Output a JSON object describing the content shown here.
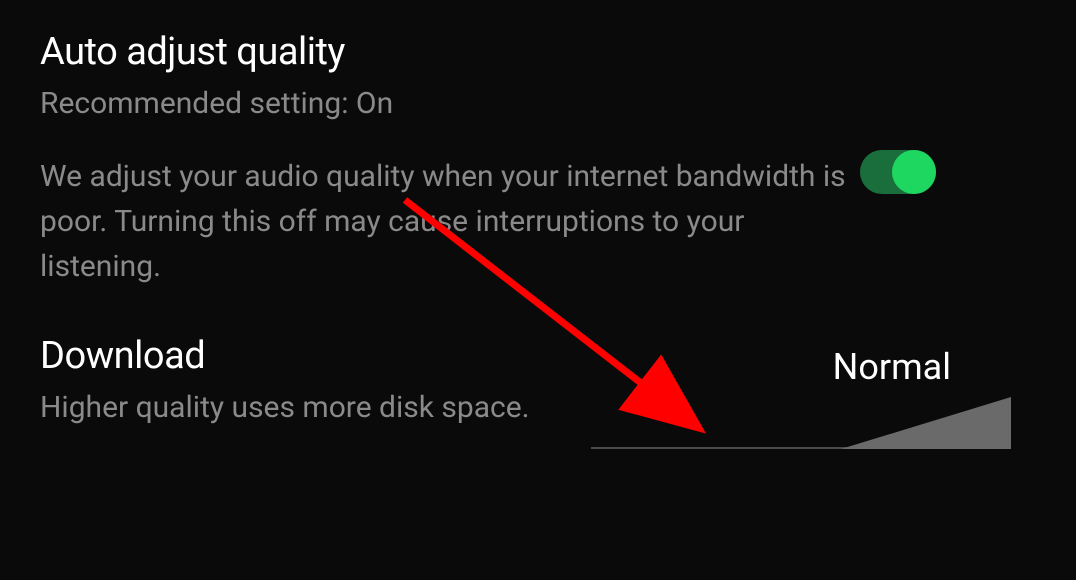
{
  "autoAdjust": {
    "title": "Auto adjust quality",
    "subtitle": "Recommended setting: On",
    "description": "We adjust your audio quality when your internet bandwidth is poor. Turning this off may cause interruptions to your listening.",
    "toggle": true
  },
  "download": {
    "title": "Download",
    "subtitle": "Higher quality uses more disk space.",
    "value": "Normal"
  }
}
